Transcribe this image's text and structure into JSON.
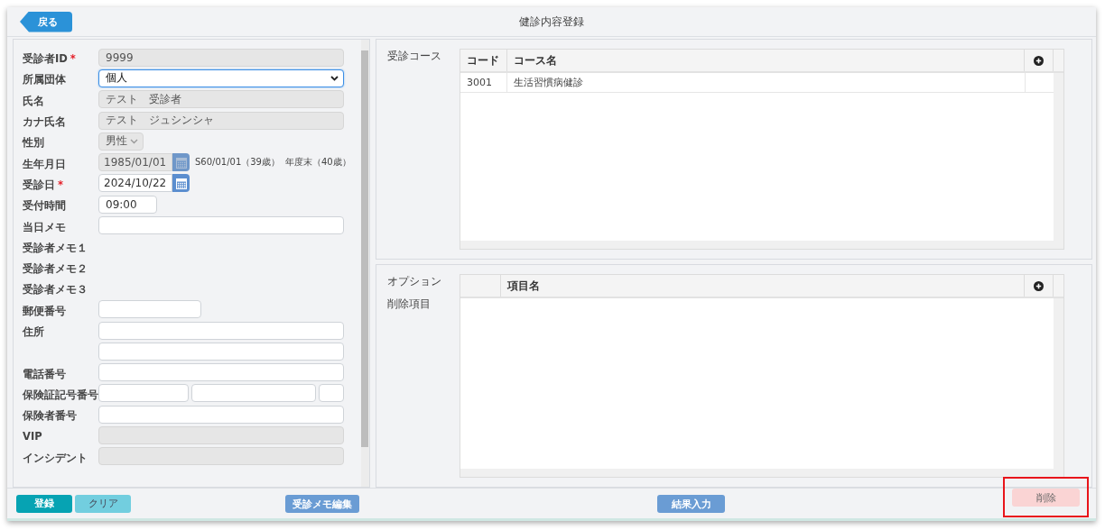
{
  "header": {
    "back_button": "戻る",
    "title": "健診内容登録"
  },
  "form": {
    "fields": [
      {
        "label": "受診者ID",
        "required_mark": "*",
        "kind": "text",
        "value": "9999",
        "disabled": true
      },
      {
        "label": "所属団体",
        "kind": "select",
        "value": "個人",
        "disabled": false,
        "focused": true
      },
      {
        "label": "氏名",
        "kind": "text",
        "value": "テスト　受診者",
        "disabled": true
      },
      {
        "label": "カナ氏名",
        "kind": "text",
        "value": "テスト　ジュシンシャ",
        "disabled": true
      },
      {
        "label": "性別",
        "kind": "small-select",
        "value": "男性",
        "disabled": true
      },
      {
        "label": "生年月日",
        "kind": "date",
        "value": "1985/01/01",
        "disabled": true,
        "notes": [
          "S60/01/01（39歳）",
          "年度末（40歳）"
        ]
      },
      {
        "label": "受診日",
        "required_mark": "*",
        "kind": "date",
        "value": "2024/10/22",
        "disabled": false
      },
      {
        "label": "受付時間",
        "kind": "time",
        "value": "09:00",
        "disabled": false
      },
      {
        "label": "当日メモ",
        "kind": "text",
        "disabled": false
      },
      {
        "label": "受診者メモ１",
        "kind": "label"
      },
      {
        "label": "受診者メモ２",
        "kind": "label"
      },
      {
        "label": "受診者メモ３",
        "kind": "label"
      },
      {
        "label": "郵便番号",
        "kind": "short",
        "disabled": false
      },
      {
        "label": "住所",
        "kind": "text",
        "disabled": false
      },
      {
        "kind": "text",
        "disabled": false
      },
      {
        "label": "電話番号",
        "kind": "text",
        "disabled": false
      },
      {
        "label": "保険証記号番号",
        "kind": "triple",
        "disabled": false
      },
      {
        "label": "保険者番号",
        "kind": "text",
        "disabled": false
      },
      {
        "label": "VIP",
        "kind": "text",
        "disabled": true
      },
      {
        "label": "インシデント",
        "kind": "text",
        "disabled": true
      }
    ]
  },
  "course": {
    "label": "受診コース",
    "columns": [
      "コード",
      "コース名"
    ],
    "rows": [
      [
        "3001",
        "生活習慣病健診"
      ]
    ]
  },
  "options": {
    "labels": [
      "オプション",
      "削除項目"
    ],
    "columns": [
      "項目名"
    ]
  },
  "footer": {
    "buttons": [
      {
        "label": "登録",
        "kind": "primary"
      },
      {
        "label": "クリア",
        "kind": "secondary"
      },
      {
        "label": "受診メモ編集",
        "kind": "info"
      },
      {
        "label": "結果入力",
        "kind": "info"
      },
      {
        "label": "削除",
        "kind": "danger",
        "highlighted": true
      }
    ]
  }
}
